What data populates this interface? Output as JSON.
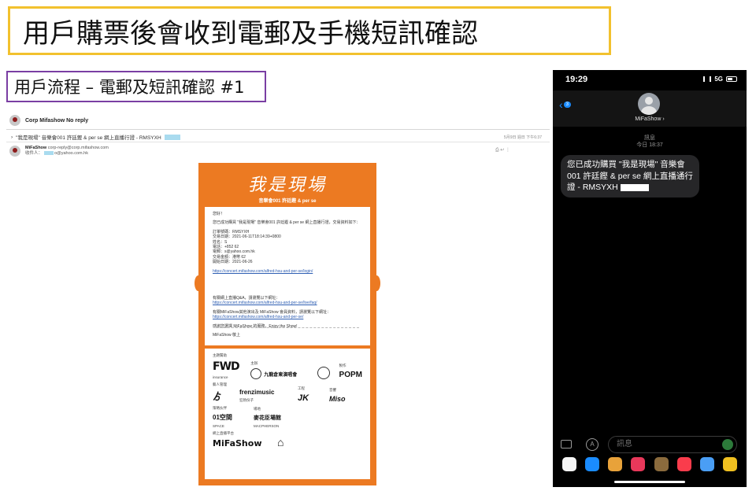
{
  "slide": {
    "title": "用戶購票後會收到電郵及手機短訊確認",
    "subtitle": "用戶流程 – 電郵及短訊確認 #1"
  },
  "email": {
    "sender_name": "Corp Mifashow No reply",
    "subject": "\"我是現場\" 音樂會001 許廷鏗 & per se 網上直播行證 - RMSYXH",
    "date": "5月9日 週日 下午6:37",
    "from_name": "MiFaShow",
    "from_addr": "corp-reply@corp.mifashow.com",
    "to_label": "收件人：",
    "to_addr": "o@yahoo.com.hk",
    "toolbar": "⎙  ↩  ⋮",
    "ticket": {
      "brand_script": "我是現場",
      "brand_tag": "音樂會001 許廷鏗 & per se",
      "greeting": "您好！",
      "intro": "您已成功購買 \"我是現場\" 音樂會001 許廷鏗 & per se 網上直播行證，交易資料如下：",
      "fields": [
        "訂單號碼：RMSYXH",
        "交易日期：2021-06-11T18:14:39+0800",
        "姓名：S",
        "電話：+852 62",
        "電郵：s@yahoo.com.hk",
        "交易金額：港幣 62",
        "開始日期：2021-06-26"
      ],
      "login_link": "https://concert.mifashow.com/alfred-hsu-and-per-se/login/",
      "qa_text": "有關網上直播Q&A，請瀏覽以下網址：",
      "qa_link": "https://concert.mifashow.com/alfred-hsu-and-per-se/live/faq/",
      "more_text": "有關MiFaShow其他演出及 MiFaShow 會員資料，請瀏覽以下網址：",
      "more_link": "https://concert.mifashow.com/alfred-hsu-and-per-se/",
      "thanks": "感謝您選擇 MiFaShow 的服務，Enjoy the Show!",
      "signoff": "MiFaShow 敬上",
      "sponsors": {
        "title_sponsor": "主題贊助",
        "organizer": "主辦",
        "producer": "製作",
        "artist_mgmt": "藝人管理",
        "engineering": "工程",
        "sound": "音響",
        "partner": "策略伙伴",
        "venue": "場地",
        "platform": "網上直播平台",
        "logos": {
          "fwd": "FWD",
          "fwd_sub": "insurance",
          "organizer_logo": "九龍倉東演唱會",
          "popm": "POPM",
          "frenzi": "frenzimusic",
          "frenzi_sub": "狂熱份子",
          "jk": "JK",
          "miso": "Miso",
          "space": "01空間",
          "space_sub": "SPACE",
          "macpherson": "麥花臣場館",
          "macpherson_sub": "MACPHERSON",
          "mifashow": "MiFaShow"
        }
      }
    }
  },
  "phone": {
    "time": "19:29",
    "network": "5G",
    "back_count": "3",
    "contact": "MiFaShow",
    "meta_label": "訊息",
    "meta_time": "今日 18:37",
    "message": "您已成功購買 \"我是現場\" 音樂會001 許廷鏗 & per se 網上直播通行證 - RMSYXH",
    "input_placeholder": "訊息",
    "app_colors": [
      "#f5f5f5",
      "#1a8cff",
      "#e8a23a",
      "#e8385a",
      "#8b6b3d",
      "#fa3c4c",
      "#4a9ef5",
      "#f0c020"
    ]
  }
}
